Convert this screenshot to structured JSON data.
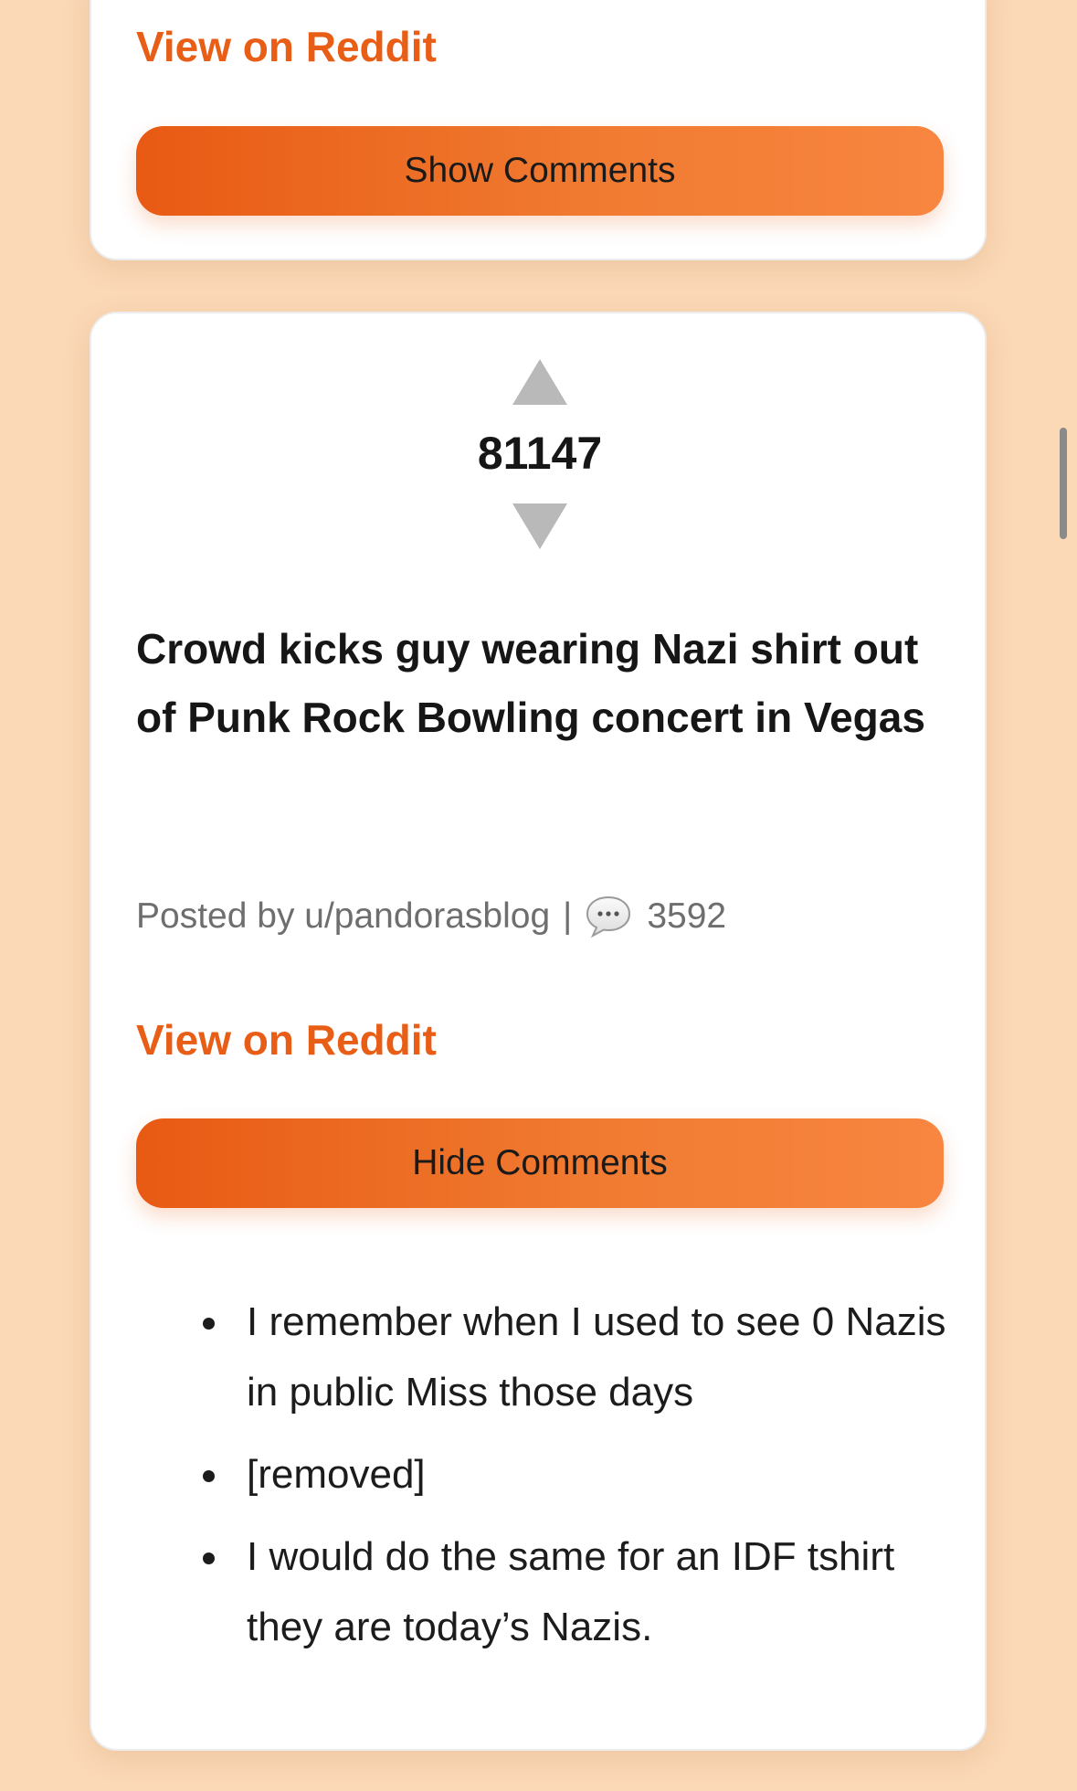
{
  "previous_post": {
    "view_link_label": "View on Reddit",
    "comments_button_label": "Show Comments"
  },
  "post": {
    "score": "81147",
    "title": "Crowd kicks guy wearing Nazi shirt out of Punk Rock Bowling concert in Vegas",
    "meta": {
      "posted_by": "Posted by u/pandorasblog",
      "separator": "|",
      "comment_count": "3592"
    },
    "view_link_label": "View on Reddit",
    "comments_button_label": "Hide Comments",
    "comments": [
      "I remember when I used to see 0 Nazis in public Miss those days",
      "[removed]",
      "I would do the same for an IDF tshirt they are today’s Nazis."
    ]
  },
  "icons": {
    "upvote": "upvote-arrow-icon",
    "downvote": "downvote-arrow-icon",
    "comment": "speech-bubble-icon"
  },
  "colors": {
    "background": "#fbd8b6",
    "accent": "#e85e16",
    "button_gradient_start": "#e85a14",
    "button_gradient_end": "#f88640",
    "vote_arrow": "#b9b9b9"
  }
}
